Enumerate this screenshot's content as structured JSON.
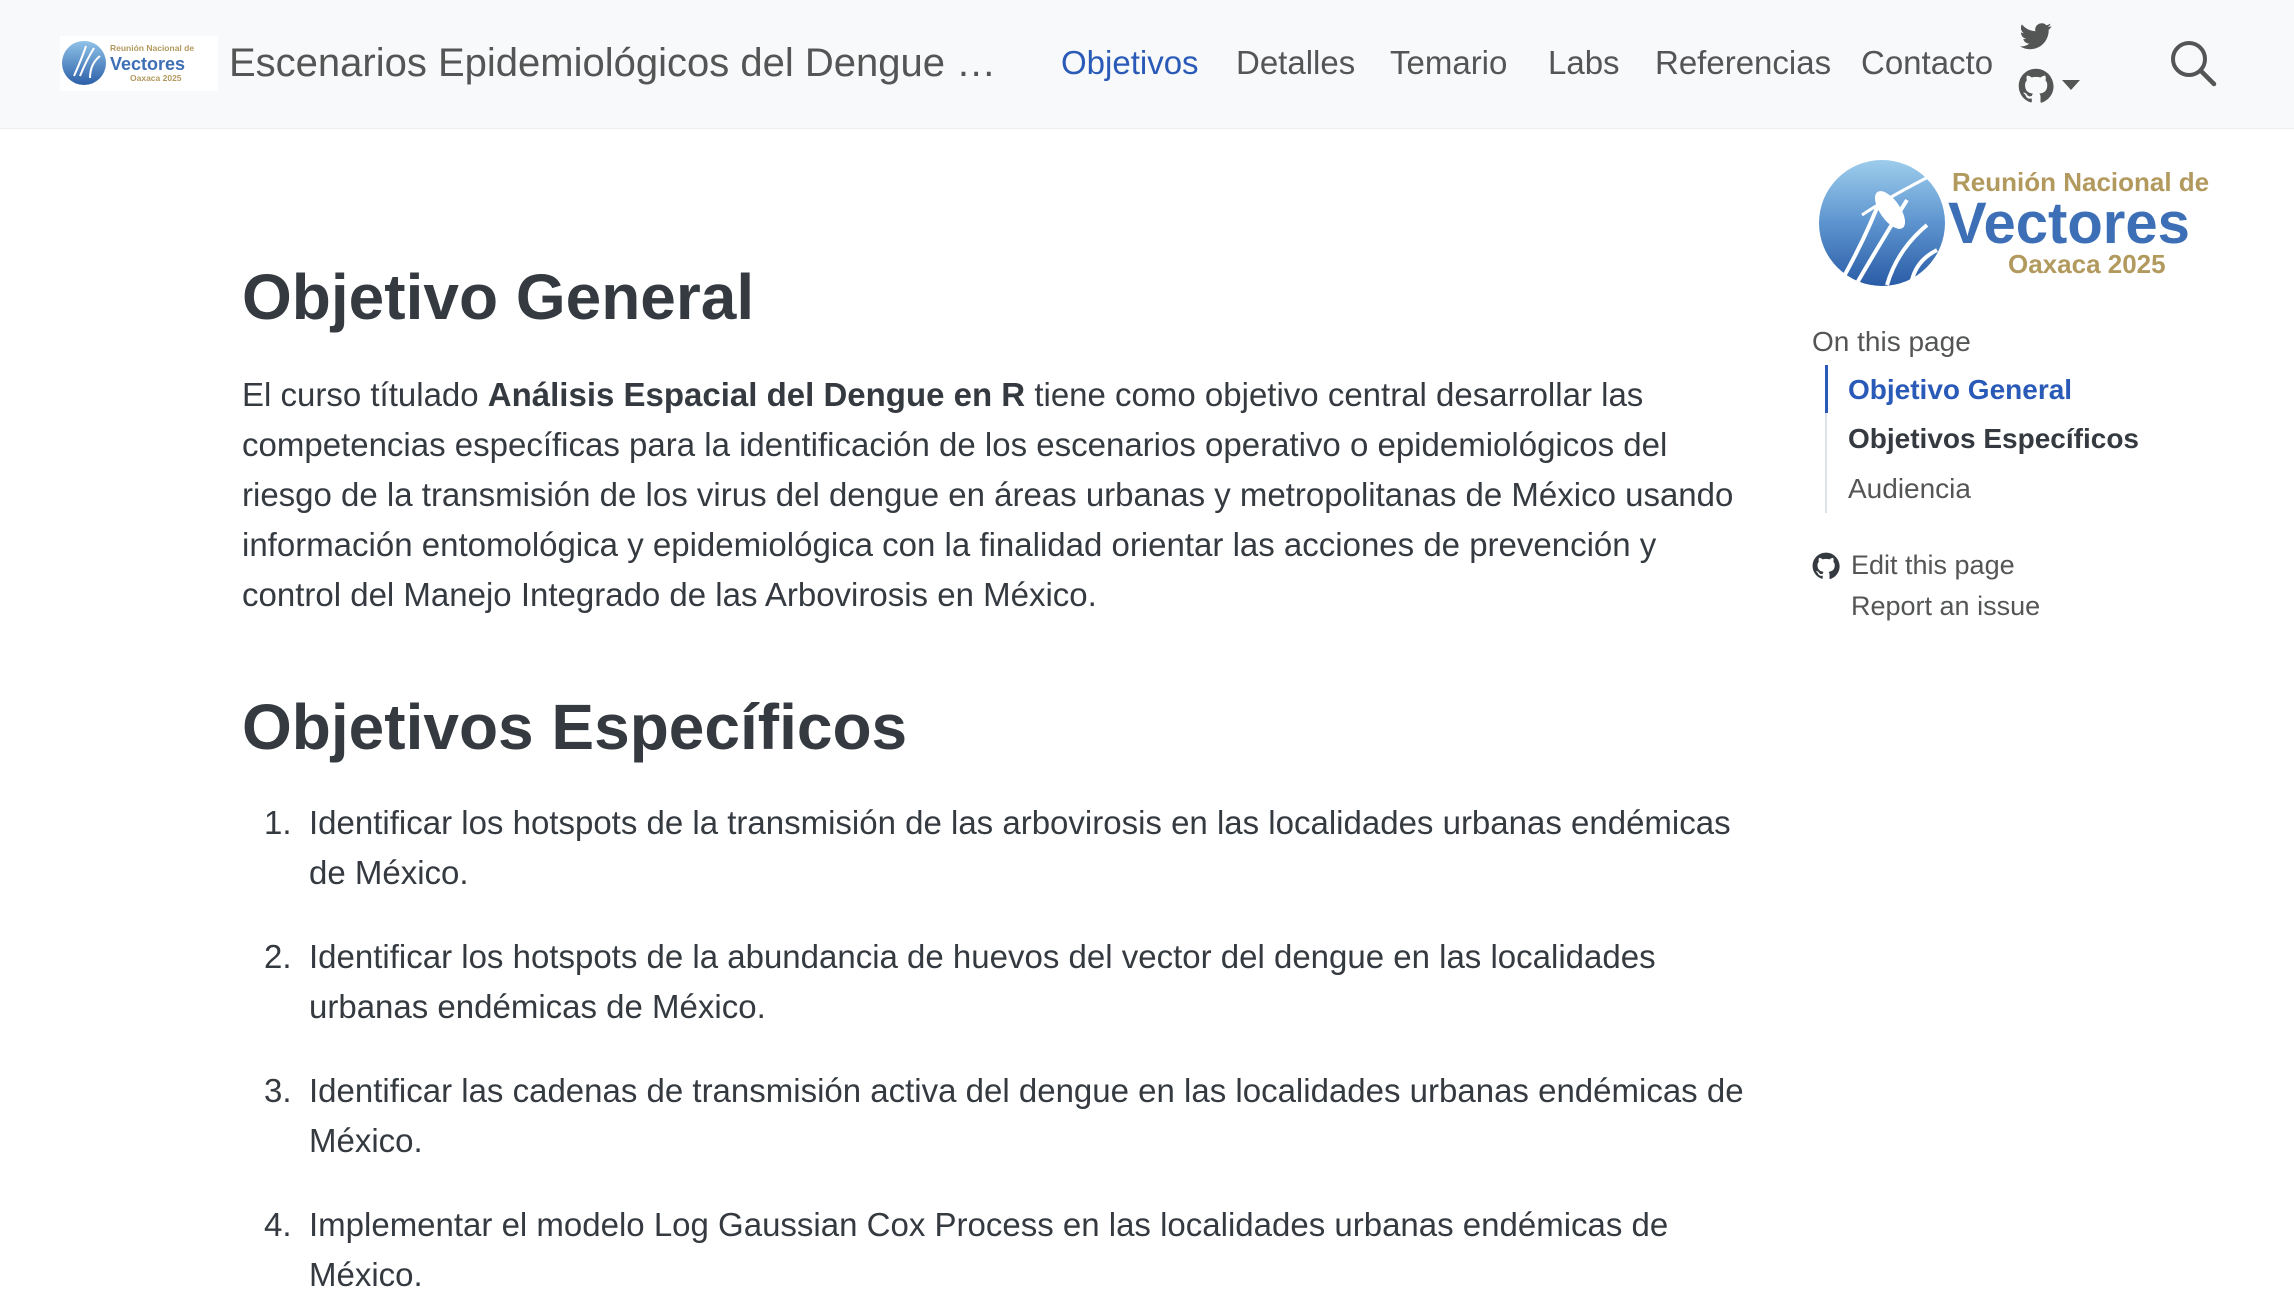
{
  "header": {
    "logo_text": {
      "line1": "Reunión Nacional de",
      "line2": "Vectores",
      "line3": "Oaxaca 2025"
    },
    "site_title": "Escenarios Epidemiológicos del Dengue en México",
    "nav": [
      {
        "label": "Objetivos",
        "active": true
      },
      {
        "label": "Detalles",
        "active": false
      },
      {
        "label": "Temario",
        "active": false
      },
      {
        "label": "Labs",
        "active": false
      },
      {
        "label": "Referencias",
        "active": false
      },
      {
        "label": "Contacto",
        "active": false
      }
    ],
    "icons": [
      "twitter-icon",
      "github-icon",
      "caret-down-icon",
      "search-icon"
    ]
  },
  "main": {
    "heading_general": "Objetivo General",
    "general_pre": "El curso títulado ",
    "general_bold": "Análisis Espacial del Dengue en R",
    "general_post": " tiene como objetivo central desarrollar las competencias específicas para la identificación de los escenarios operativo o epidemiológicos del riesgo de la transmisión de los virus del dengue en áreas urbanas y metropolitanas de México usando información entomológica y epidemiológica con la finalidad orientar las acciones de prevención y control del Manejo Integrado de las Arbovirosis en México.",
    "heading_specific": "Objetivos Específicos",
    "specific_items": [
      {
        "num": "1.",
        "text": "Identificar los hotspots de la transmisión de las arbovirosis en las localidades urbanas endémicas de México."
      },
      {
        "num": "2.",
        "text": "Identificar los hotspots de la abundancia de huevos del vector del dengue en las localidades urbanas endémicas de México."
      },
      {
        "num": "3.",
        "text": "Identificar las cadenas de transmisión activa del dengue en las localidades urbanas endémicas de México."
      },
      {
        "num": "4.",
        "text": "Implementar el modelo Log Gaussian Cox Process en las localidades urbanas endémicas de México."
      }
    ]
  },
  "sidebar": {
    "logo_text": {
      "line1": "Reunión Nacional de",
      "line2": "Vectores",
      "line3": "Oaxaca 2025"
    },
    "toc_title": "On this page",
    "toc": [
      {
        "label": "Objetivo General",
        "state": "active"
      },
      {
        "label": "Objetivos Específicos",
        "state": "bold"
      },
      {
        "label": "Audiencia",
        "state": "normal"
      }
    ],
    "actions": {
      "edit": "Edit this page",
      "report": "Report an issue"
    }
  },
  "colors": {
    "accent": "#2a5ab8",
    "header_bg": "#f8f9fa",
    "text": "#343a40",
    "muted": "#545555",
    "logo_blue": "#3d6fb6",
    "logo_gold": "#b29a5f"
  }
}
